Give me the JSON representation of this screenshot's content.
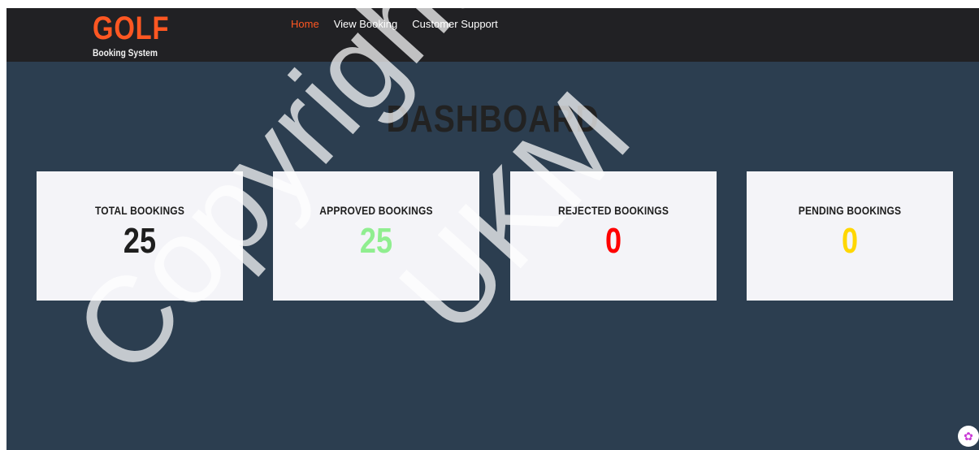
{
  "brand": {
    "title": "GOLF",
    "subtitle": "Booking System"
  },
  "nav": [
    {
      "label": "Home",
      "active": true
    },
    {
      "label": "View Booking",
      "active": false
    },
    {
      "label": "Customer Support",
      "active": false
    }
  ],
  "page_title": "DASHBOARD",
  "cards": [
    {
      "label": "TOTAL BOOKINGS",
      "value": "25",
      "color": "#1e1e1e"
    },
    {
      "label": "APPROVED BOOKINGS",
      "value": "25",
      "color": "#90ee90"
    },
    {
      "label": "REJECTED BOOKINGS",
      "value": "0",
      "color": "#ff0000"
    },
    {
      "label": "PENDING BOOKINGS",
      "value": "0",
      "color": "#ffd700"
    }
  ],
  "watermark": {
    "line1": "Copyright@",
    "line2": "UKM"
  },
  "colors": {
    "navbar": "#212124",
    "background": "#2c3e50",
    "accent": "#ff5722"
  },
  "icons": {
    "assistant": "brain-icon"
  }
}
